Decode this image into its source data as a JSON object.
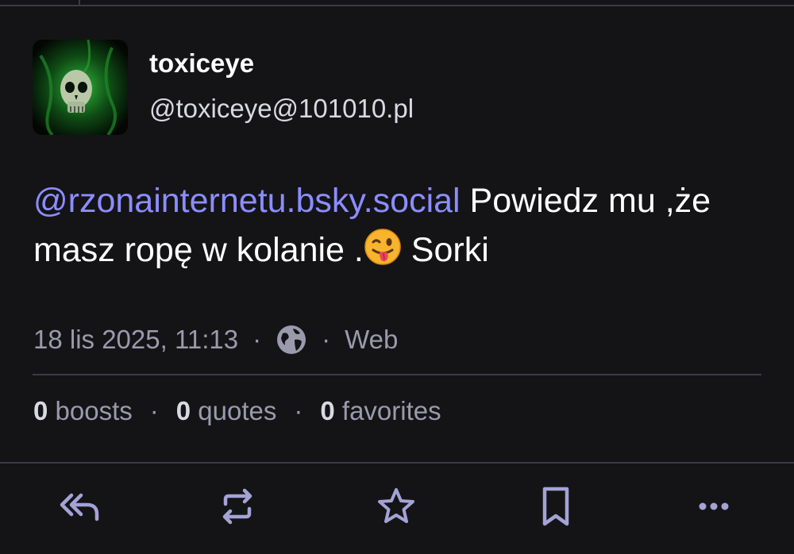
{
  "author": {
    "display_name": "toxiceye",
    "handle": "@toxiceye@101010.pl",
    "avatar_icon": "skull-avatar"
  },
  "post": {
    "mention": "@rzonainternetu.bsky.social",
    "text_before_emoji": " Powiedz mu ,że masz ropę w kolanie .",
    "emoji": "winking-face-with-tongue",
    "text_after_emoji": " Sorki"
  },
  "meta": {
    "timestamp": "18 lis 2025, 11:13",
    "separator": "·",
    "visibility_icon": "globe-icon",
    "application": "Web"
  },
  "stats": {
    "boosts_count": "0",
    "boosts_label": " boosts",
    "quotes_count": "0",
    "quotes_label": " quotes",
    "favorites_count": "0",
    "favorites_label": " favorites",
    "separator": "·"
  },
  "actions": [
    "reply-all-icon",
    "boost-icon",
    "favorite-star-icon",
    "bookmark-icon",
    "more-icon"
  ],
  "colors": {
    "background": "#141416",
    "mention": "#8c8dff",
    "muted": "#9b9aad",
    "divider": "#3b3a47",
    "action_icon": "#a3a3d6"
  }
}
